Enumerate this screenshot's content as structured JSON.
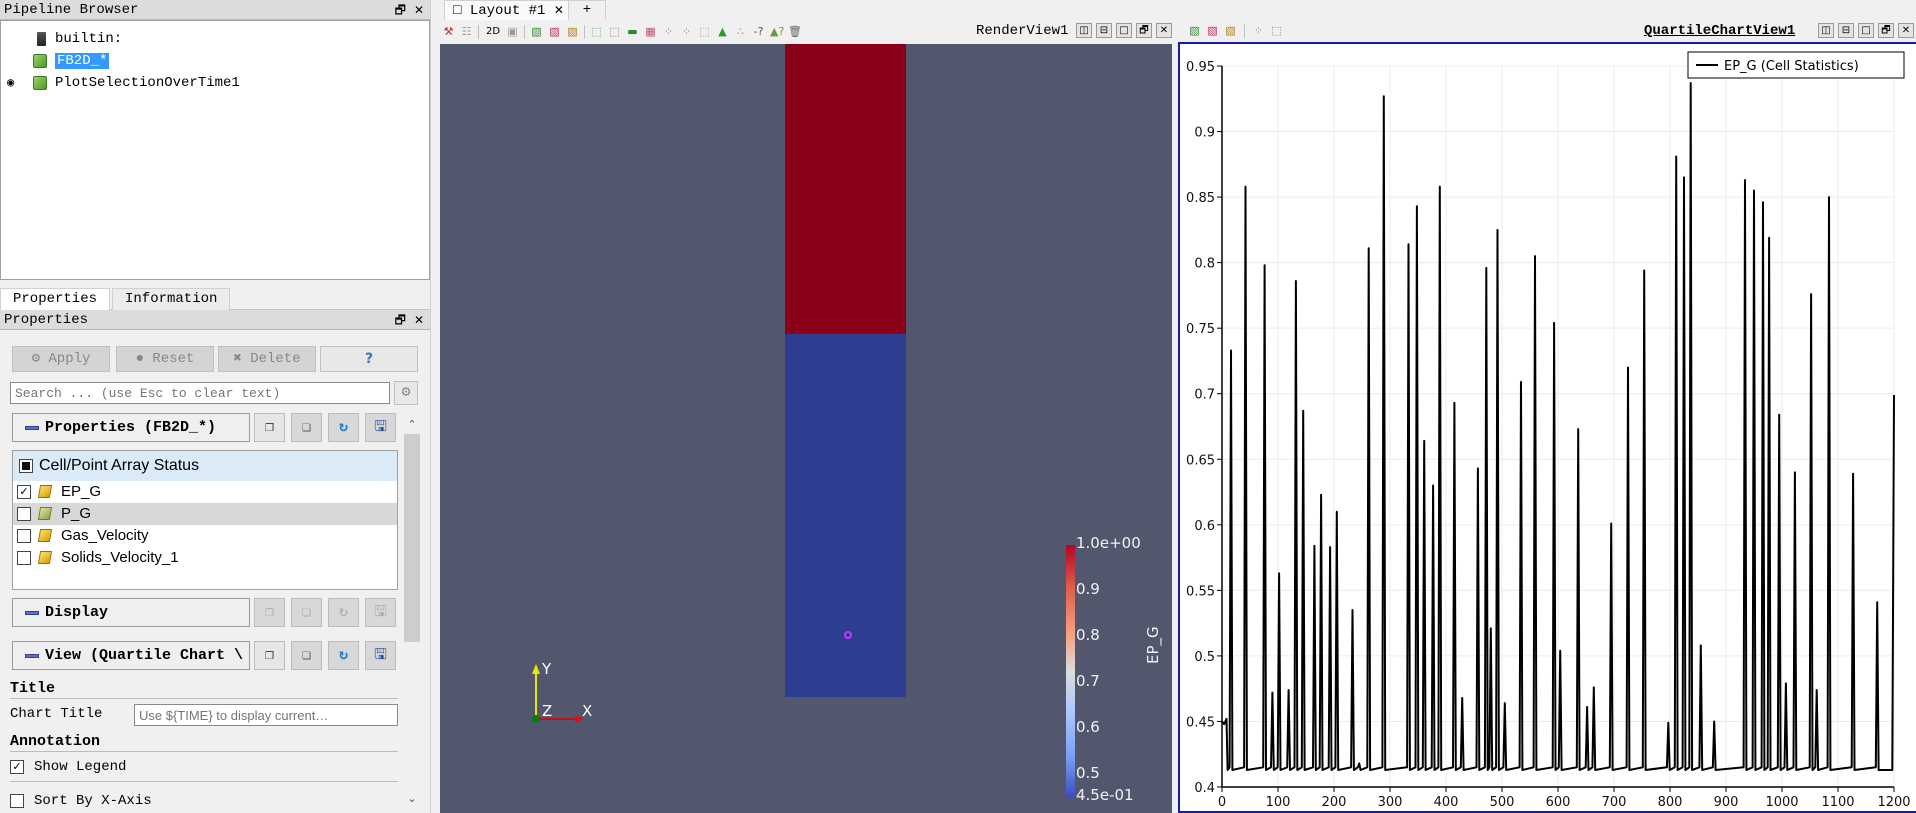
{
  "pipeline_browser": {
    "title": "Pipeline Browser",
    "items": [
      {
        "label": "builtin:",
        "icon": "server-icon"
      },
      {
        "label": "FB2D_*",
        "icon": "dataset-cube-icon",
        "selected": true
      },
      {
        "label": "PlotSelectionOverTime1",
        "icon": "dataset-cube-icon",
        "visible": true
      }
    ]
  },
  "panel_tabs": [
    "Properties",
    "Information"
  ],
  "properties": {
    "title": "Properties",
    "apply_label": "Apply",
    "reset_label": "Reset",
    "delete_label": "Delete",
    "help_label": "?",
    "search_placeholder": "Search ... (use Esc to clear text)",
    "sections": {
      "properties": "Properties (FB2D_*)",
      "display": "Display",
      "view": "View (Quartile Chart \\"
    },
    "array_status": {
      "header": "Cell/Point Array Status",
      "rows": [
        {
          "label": "EP_G",
          "checked": true
        },
        {
          "label": "P_G",
          "checked": false
        },
        {
          "label": "Gas_Velocity",
          "checked": false
        },
        {
          "label": "Solids_Velocity_1",
          "checked": false
        }
      ]
    },
    "title_group": "Title",
    "chart_title_label": "Chart Title",
    "chart_title_placeholder": "Use ${TIME} to display current…",
    "annotation_group": "Annotation",
    "show_legend_label": "Show Legend",
    "show_legend_checked": true,
    "sort_by_x_label": "Sort By X-Axis",
    "sort_by_x_checked": false
  },
  "layout_tabs": {
    "active": "Layout #1",
    "add": "+"
  },
  "render_view": {
    "title": "RenderView1",
    "toolbar_2d_label": "2D",
    "background_color": "#52576e",
    "upper_region_color": "#8b0019",
    "lower_region_color": "#2d3e91",
    "probe_color": "#cc33ff",
    "axes": {
      "x": "X",
      "y": "Y",
      "z": "Z"
    },
    "color_legend": {
      "title": "EP_G",
      "ticks": [
        "1.0e+00",
        "0.9",
        "0.8",
        "0.7",
        "0.6",
        "0.5",
        "4.5e-01"
      ],
      "range": [
        0.45,
        1.0
      ]
    }
  },
  "chart_view": {
    "title": "QuartileChartView1"
  },
  "chart_data": {
    "type": "line",
    "title": "",
    "xlabel": "",
    "ylabel": "",
    "xlim": [
      0,
      1200
    ],
    "ylim": [
      0.4,
      0.95
    ],
    "xticks": [
      "0",
      "100",
      "200",
      "300",
      "400",
      "500",
      "600",
      "700",
      "800",
      "900",
      "1000",
      "1100",
      "1200"
    ],
    "yticks": [
      "0.4",
      "0.45",
      "0.5",
      "0.55",
      "0.6",
      "0.65",
      "0.7",
      "0.75",
      "0.8",
      "0.85",
      "0.9",
      "0.95"
    ],
    "grid": true,
    "legend_position": "top-right",
    "baseline": 0.413,
    "series": [
      {
        "name": "EP_G (Cell Statistics)",
        "color": "#000000",
        "start": [
          [
            0,
            0.45
          ],
          [
            4,
            0.448
          ],
          [
            8,
            0.452
          ]
        ],
        "peaks": [
          [
            16,
            0.733
          ],
          [
            42,
            0.858
          ],
          [
            76,
            0.798
          ],
          [
            90,
            0.472
          ],
          [
            102,
            0.563
          ],
          [
            119,
            0.474
          ],
          [
            132,
            0.786
          ],
          [
            145,
            0.687
          ],
          [
            165,
            0.584
          ],
          [
            177,
            0.623
          ],
          [
            193,
            0.583
          ],
          [
            205,
            0.61
          ],
          [
            233,
            0.535
          ],
          [
            245,
            0.418
          ],
          [
            262,
            0.811
          ],
          [
            289,
            0.927
          ],
          [
            333,
            0.814
          ],
          [
            348,
            0.843
          ],
          [
            361,
            0.664
          ],
          [
            377,
            0.63
          ],
          [
            389,
            0.858
          ],
          [
            415,
            0.693
          ],
          [
            429,
            0.468
          ],
          [
            457,
            0.643
          ],
          [
            472,
            0.796
          ],
          [
            480,
            0.521
          ],
          [
            492,
            0.825
          ],
          [
            505,
            0.464
          ],
          [
            534,
            0.709
          ],
          [
            559,
            0.805
          ],
          [
            593,
            0.754
          ],
          [
            604,
            0.504
          ],
          [
            636,
            0.673
          ],
          [
            652,
            0.461
          ],
          [
            664,
            0.476
          ],
          [
            695,
            0.601
          ],
          [
            725,
            0.72
          ],
          [
            754,
            0.794
          ],
          [
            797,
            0.449
          ],
          [
            811,
            0.881
          ],
          [
            825,
            0.865
          ],
          [
            837,
            0.937
          ],
          [
            855,
            0.508
          ],
          [
            879,
            0.45
          ],
          [
            934,
            0.863
          ],
          [
            950,
            0.855
          ],
          [
            966,
            0.846
          ],
          [
            977,
            0.819
          ],
          [
            995,
            0.684
          ],
          [
            1007,
            0.479
          ],
          [
            1023,
            0.64
          ],
          [
            1052,
            0.776
          ],
          [
            1062,
            0.474
          ],
          [
            1084,
            0.85
          ],
          [
            1127,
            0.639
          ],
          [
            1170,
            0.541
          ]
        ],
        "end": [
          1200,
          0.699
        ]
      }
    ]
  }
}
